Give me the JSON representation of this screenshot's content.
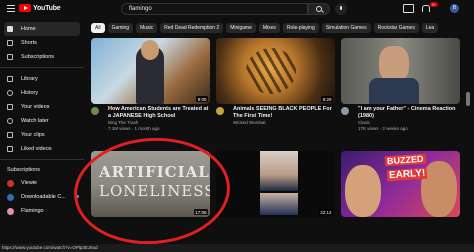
{
  "header": {
    "logo_text": "YouTube",
    "search_value": "flamingo",
    "notification_count": "9+",
    "avatar_letter": "B"
  },
  "sidebar": {
    "main_items": [
      {
        "label": "Home",
        "icon": "home-icon"
      },
      {
        "label": "Shorts",
        "icon": "shorts-icon"
      },
      {
        "label": "Subscriptions",
        "icon": "subscriptions-icon"
      }
    ],
    "library_items": [
      {
        "label": "Library",
        "icon": "library-icon"
      },
      {
        "label": "History",
        "icon": "history-icon"
      },
      {
        "label": "Your videos",
        "icon": "your-videos-icon"
      },
      {
        "label": "Watch later",
        "icon": "watch-later-icon"
      },
      {
        "label": "Your clips",
        "icon": "clips-icon"
      },
      {
        "label": "Liked videos",
        "icon": "liked-icon"
      }
    ],
    "subscriptions_heading": "Subscriptions",
    "subscriptions": [
      {
        "label": "Viewie"
      },
      {
        "label": "Downloadable C..."
      },
      {
        "label": "Flamingo"
      }
    ]
  },
  "chips": [
    "All",
    "Gaming",
    "Music",
    "Red Dead Redemption 2",
    "Minigame",
    "Mixes",
    "Role-playing",
    "Simulation Games",
    "Rockstar Games",
    "Lea"
  ],
  "videos": [
    {
      "title": "How American Students are Treated at a JAPANESE High School",
      "channel": "Bing The Trash",
      "meta": "7.1M views · 1 month ago",
      "duration": "9:05",
      "accent": "#6a8d4a"
    },
    {
      "title": "Animals SEEING BLACK PEOPLE For The First Time!",
      "channel": "Wicked Wombat",
      "meta": "",
      "duration": "8:29",
      "accent": "#c9a245"
    },
    {
      "title": "\"I am your Father\" - Cinema Reaction (1980)",
      "channel": "Clasic",
      "meta": "17K views · 2 weeks ago",
      "duration": "",
      "accent": "#8a9aa8"
    },
    {
      "title": "",
      "channel": "",
      "meta": "",
      "duration": "17:06",
      "thumb_text_1": "ARTIFICIAL",
      "thumb_text_2": "LONELINESS"
    },
    {
      "title": "",
      "channel": "",
      "meta": "",
      "duration": "22:12"
    },
    {
      "title": "",
      "channel": "",
      "meta": "",
      "duration": "",
      "thumb_text_1": "BUZZED",
      "thumb_text_2": "EARLY!"
    }
  ],
  "status_url": "https://www.youtube.com/watch?v=OPlp3EJ6ud"
}
